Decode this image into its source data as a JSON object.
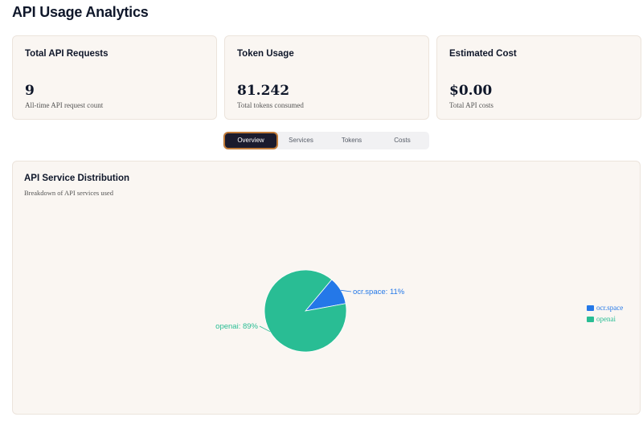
{
  "page": {
    "title": "API Usage Analytics"
  },
  "stats": [
    {
      "label": "Total API Requests",
      "value": "9",
      "sub": "All-time API request count"
    },
    {
      "label": "Token Usage",
      "value": "81.242",
      "sub": "Total tokens consumed"
    },
    {
      "label": "Estimated Cost",
      "value": "$0.00",
      "sub": "Total API costs"
    }
  ],
  "tabs": [
    {
      "label": "Overview",
      "active": true
    },
    {
      "label": "Services",
      "active": false
    },
    {
      "label": "Tokens",
      "active": false
    },
    {
      "label": "Costs",
      "active": false
    }
  ],
  "distribution": {
    "title": "API Service Distribution",
    "subtitle": "Breakdown of API services used"
  },
  "colors": {
    "ocr_space": "#2478e8",
    "openai": "#29bd94",
    "active_tab_bg": "#1b1b2d",
    "active_tab_ring": "#c07a38",
    "card_bg": "#faf6f2"
  },
  "chart_data": {
    "type": "pie",
    "title": "API Service Distribution",
    "slices": [
      {
        "name": "ocr.space",
        "value": 11,
        "label": "ocr.space: 11%",
        "color": "#2478e8"
      },
      {
        "name": "openai",
        "value": 89,
        "label": "openai: 89%",
        "color": "#29bd94"
      }
    ],
    "legend": {
      "position": "right",
      "entries": [
        "ocr.space",
        "openai"
      ]
    }
  }
}
